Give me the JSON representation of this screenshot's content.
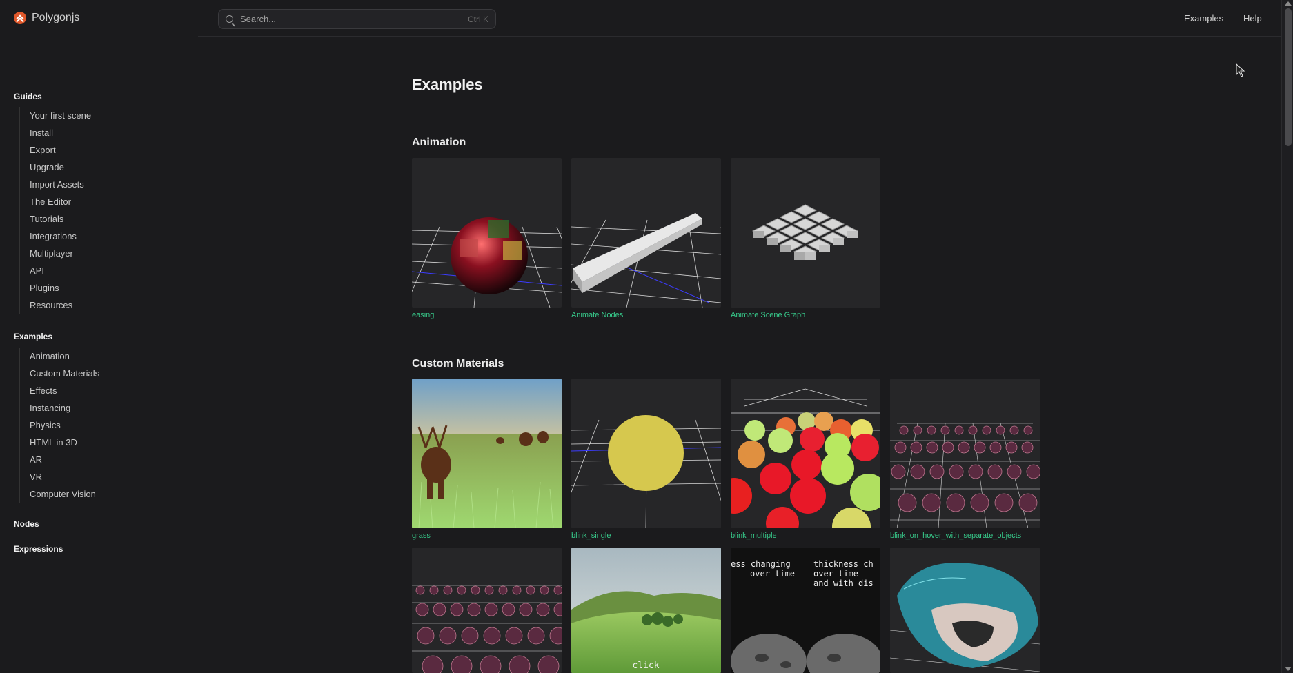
{
  "brand": {
    "name": "Polygonjs"
  },
  "search": {
    "placeholder": "Search...",
    "shortcut": "Ctrl K"
  },
  "top_nav": {
    "examples": "Examples",
    "help": "Help"
  },
  "sidebar": {
    "guides": {
      "title": "Guides",
      "items": [
        "Your first scene",
        "Install",
        "Export",
        "Upgrade",
        "Import Assets",
        "The Editor",
        "Tutorials",
        "Integrations",
        "Multiplayer",
        "API",
        "Plugins",
        "Resources"
      ]
    },
    "examples": {
      "title": "Examples",
      "items": [
        "Animation",
        "Custom Materials",
        "Effects",
        "Instancing",
        "Physics",
        "HTML in 3D",
        "AR",
        "VR",
        "Computer Vision"
      ]
    },
    "nodes": {
      "title": "Nodes"
    },
    "expressions": {
      "title": "Expressions"
    }
  },
  "main": {
    "title": "Examples",
    "sections": [
      {
        "title": "Animation",
        "cards": [
          "easing",
          "Animate Nodes",
          "Animate Scene Graph"
        ]
      },
      {
        "title": "Custom Materials",
        "cards": [
          "grass",
          "blink_single",
          "blink_multiple",
          "blink_on_hover_with_separate_objects"
        ]
      }
    ],
    "partial_row_text": {
      "left": "ess changing\n over time",
      "right": "thickness ch\n over time\n and with dis",
      "click": "click"
    }
  },
  "colors": {
    "accent": "#37c98a",
    "background": "#1b1b1d",
    "brand": "#e0582b"
  }
}
